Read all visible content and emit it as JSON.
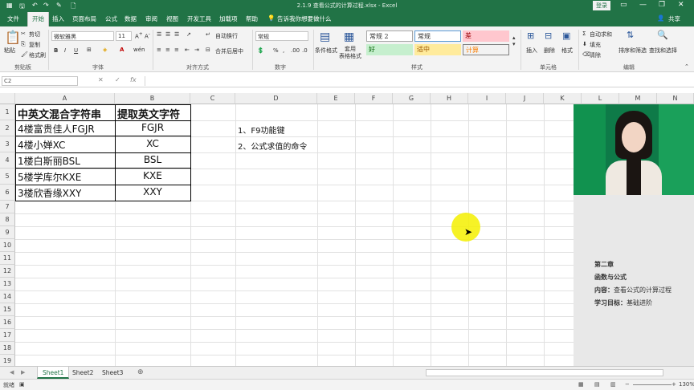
{
  "window": {
    "title": "2.1.9 查看公式的计算过程.xlsx - Excel",
    "login_label": "登录",
    "share_label": "共享",
    "minimize": "—",
    "restore": "❐",
    "close": "✕"
  },
  "ribbon_tabs": [
    {
      "label": "文件"
    },
    {
      "label": "开始"
    },
    {
      "label": "插入"
    },
    {
      "label": "页面布局"
    },
    {
      "label": "公式"
    },
    {
      "label": "数据"
    },
    {
      "label": "审阅"
    },
    {
      "label": "视图"
    },
    {
      "label": "开发工具"
    },
    {
      "label": "加载项"
    },
    {
      "label": "帮助"
    }
  ],
  "tellme": "告诉我你想要做什么",
  "clipboard": {
    "paste": "粘贴",
    "cut": "剪切",
    "copy": "复制",
    "format_painter": "格式刷",
    "group": "剪贴板"
  },
  "font": {
    "name": "微软雅黑",
    "size": "11",
    "group": "字体",
    "bold": "B",
    "italic": "I",
    "underline": "U"
  },
  "alignment": {
    "wrap": "自动换行",
    "merge": "合并后居中",
    "group": "对齐方式"
  },
  "number": {
    "format": "常规",
    "percent": "%",
    "group": "数字"
  },
  "styles": {
    "conditional": "条件格式",
    "table_format": "套用\n表格格式",
    "group": "样式",
    "cells": [
      {
        "label": "常规 2",
        "bg": "#ffffff",
        "fg": "#333333"
      },
      {
        "label": "常规",
        "bg": "#ffffff",
        "fg": "#333333"
      },
      {
        "label": "差",
        "bg": "#ffc7ce",
        "fg": "#9c0006"
      },
      {
        "label": "好",
        "bg": "#c6efce",
        "fg": "#006100"
      },
      {
        "label": "适中",
        "bg": "#ffeb9c",
        "fg": "#9c5700"
      },
      {
        "label": "计算",
        "bg": "#f2f2f2",
        "fg": "#fa7d00"
      }
    ]
  },
  "cells_group": {
    "insert": "插入",
    "delete": "删除",
    "format": "格式",
    "group": "单元格"
  },
  "editing": {
    "autosum": "自动求和",
    "fill": "填充",
    "clear": "清除",
    "sort": "排序和筛选",
    "find": "查找和选择",
    "group": "编辑"
  },
  "formula_bar": {
    "name_box": "C2",
    "cancel": "✕",
    "enter": "✓",
    "fx": "fx",
    "content": ""
  },
  "columns": [
    "A",
    "B",
    "C",
    "D",
    "E",
    "F",
    "G",
    "H",
    "I",
    "J",
    "K",
    "L",
    "M",
    "N"
  ],
  "rows": [
    "1",
    "2",
    "3",
    "4",
    "5",
    "6",
    "7",
    "8",
    "9",
    "10",
    "11",
    "12",
    "13",
    "14",
    "15",
    "16",
    "17",
    "18",
    "19",
    "20"
  ],
  "table": {
    "header": [
      "中英文混合字符串",
      "提取英文字符"
    ],
    "rows": [
      [
        "4楼富贵佳人FGJR",
        "FGJR"
      ],
      [
        "4楼小婵XC",
        "XC"
      ],
      [
        "1楼白斯丽BSL",
        "BSL"
      ],
      [
        "5楼学库尔KXE",
        "KXE"
      ],
      [
        "3楼欣香缘XXY",
        "XXY"
      ]
    ]
  },
  "notes": [
    "1、F9功能键",
    "2、公式求值的命令"
  ],
  "panel": {
    "chapter": "第二章",
    "topic": "函数与公式",
    "content_label": "内容：",
    "content": "查看公式的计算过程",
    "goal_label": "学习目标：",
    "goal": "基础进阶"
  },
  "sheets": [
    "Sheet1",
    "Sheet2",
    "Sheet3"
  ],
  "status": {
    "mode": "就绪",
    "zoom": "130%"
  },
  "colors": {
    "accent": "#217346"
  }
}
